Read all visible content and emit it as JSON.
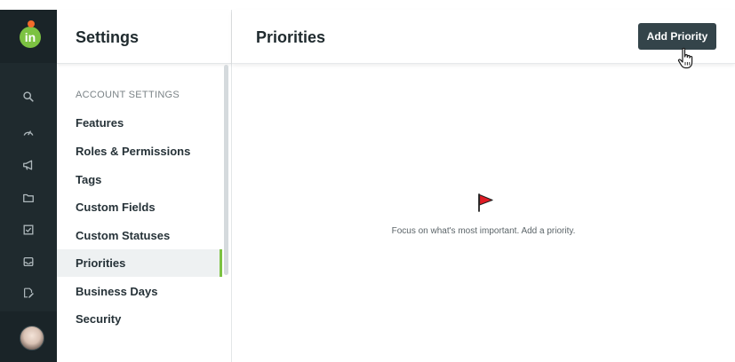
{
  "app": {
    "logo_text": "in",
    "brand_color": "#7cc242",
    "rail_color": "#1f2a2e"
  },
  "rail": {
    "icons": [
      "search-icon",
      "dashboard-gauge-icon",
      "megaphone-icon",
      "folder-icon",
      "checkbox-icon",
      "inbox-icon",
      "edit-document-icon"
    ],
    "avatar": "user-avatar"
  },
  "sidebar": {
    "title": "Settings",
    "section_label": "ACCOUNT SETTINGS",
    "items": [
      {
        "label": "Features"
      },
      {
        "label": "Roles & Permissions"
      },
      {
        "label": "Tags"
      },
      {
        "label": "Custom Fields"
      },
      {
        "label": "Custom Statuses"
      },
      {
        "label": "Priorities",
        "active": true
      },
      {
        "label": "Business Days"
      },
      {
        "label": "Security"
      }
    ]
  },
  "main": {
    "title": "Priorities",
    "add_button_label": "Add Priority",
    "empty_state": {
      "icon": "red-flag-icon",
      "message": "Focus on what's most important. Add a priority."
    }
  }
}
